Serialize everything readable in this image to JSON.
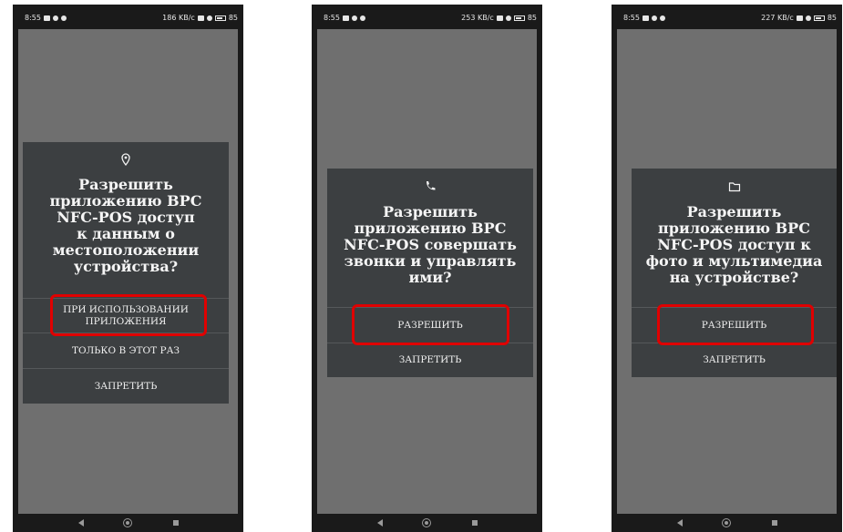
{
  "highlight_color": "#e00000",
  "phones": [
    {
      "status": {
        "time": "8:55",
        "speed": "186 KB/c",
        "battery": "85"
      },
      "dialog": {
        "icon": "location-pin-icon",
        "title": "Разрешить\nприложению BPC\nNFC-POS доступ\nк данным о\nместоположении\nустройства?",
        "buttons": [
          "ПРИ ИСПОЛЬЗОВАНИИ\nПРИЛОЖЕНИЯ",
          "ТОЛЬКО В ЭТОТ РАЗ",
          "ЗАПРЕТИТЬ"
        ],
        "highlighted": "ПРИ ИСПОЛЬЗОВАНИИ\nПРИЛОЖЕНИЯ"
      }
    },
    {
      "status": {
        "time": "8:55",
        "speed": "253 KB/c",
        "battery": "85"
      },
      "dialog": {
        "icon": "phone-icon",
        "title": "Разрешить\nприложению BPC\nNFC-POS совершать\nзвонки и управлять\nими?",
        "buttons": [
          "РАЗРЕШИТЬ",
          "ЗАПРЕТИТЬ"
        ],
        "highlighted": "РАЗРЕШИТЬ"
      }
    },
    {
      "status": {
        "time": "8:55",
        "speed": "227 KB/c",
        "battery": "85"
      },
      "dialog": {
        "icon": "folder-icon",
        "title": "Разрешить\nприложению BPC\nNFC-POS доступ к\nфото и мультимедиа\nна устройстве?",
        "buttons": [
          "РАЗРЕШИТЬ",
          "ЗАПРЕТИТЬ"
        ],
        "highlighted": "РАЗРЕШИТЬ"
      }
    }
  ]
}
